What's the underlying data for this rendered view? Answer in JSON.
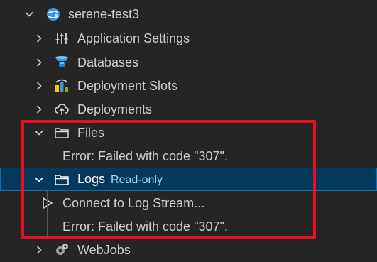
{
  "tree": {
    "root": {
      "label": "serene-test3",
      "icon": "app-service-globe-icon"
    },
    "items": [
      {
        "label": "Application Settings",
        "icon": "sliders-icon"
      },
      {
        "label": "Databases",
        "icon": "database-icon"
      },
      {
        "label": "Deployment Slots",
        "icon": "deployment-slots-icon"
      },
      {
        "label": "Deployments",
        "icon": "cloud-upload-icon"
      },
      {
        "label": "Files",
        "icon": "folder-icon"
      },
      {
        "label": "Error: Failed with code \"307\".",
        "icon": ""
      },
      {
        "label": "Logs",
        "description": "Read-only",
        "icon": "folder-icon"
      },
      {
        "label": "Connect to Log Stream...",
        "icon": "play-icon"
      },
      {
        "label": "Error: Failed with code \"307\".",
        "icon": ""
      },
      {
        "label": "WebJobs",
        "icon": "webjobs-icon"
      }
    ]
  },
  "colors": {
    "background": "#252526",
    "text": "#cccccc",
    "selection": "#04395e",
    "description": "#9cdcfe",
    "highlight_box": "#e81123"
  }
}
